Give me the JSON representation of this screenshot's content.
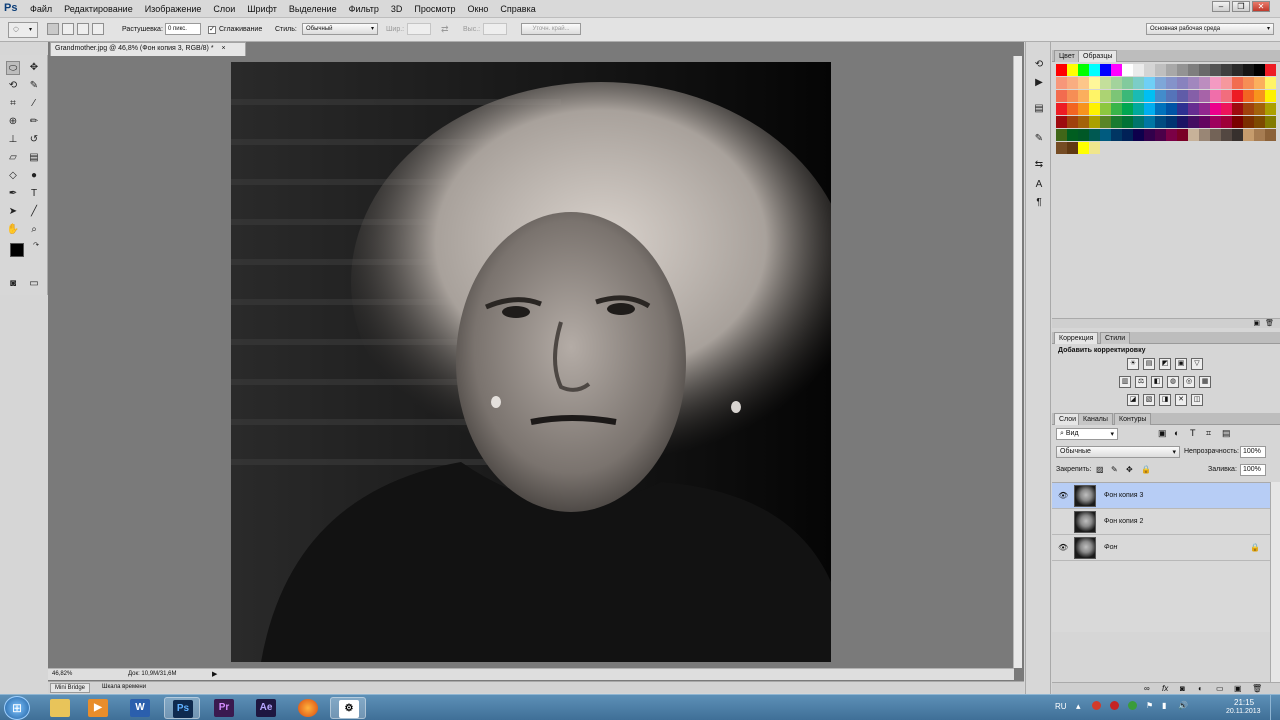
{
  "app": {
    "logo": "Ps"
  },
  "menu": [
    "Файл",
    "Редактирование",
    "Изображение",
    "Слои",
    "Шрифт",
    "Выделение",
    "Фильтр",
    "3D",
    "Просмотр",
    "Окно",
    "Справка"
  ],
  "window_controls": {
    "minimize": "–",
    "restore": "❐",
    "close": "✕"
  },
  "options": {
    "feather_label": "Растушевка:",
    "feather_value": "0 пикс.",
    "antialias_label": "Сглаживание",
    "style_label": "Стиль:",
    "style_value": "Обычный",
    "width_label": "Шир.:",
    "height_label": "Выс.:",
    "refine_button": "Уточн. край...",
    "workspace": "Основная рабочая среда"
  },
  "document": {
    "tab_title": "Grandmother.jpg @ 46,8% (Фон копия 3, RGB/8) *",
    "close": "×",
    "zoom": "46,82%",
    "doc_info": "Док: 10,9M/31,6M"
  },
  "bottom_tabs": [
    "Mini Bridge",
    "Шкала времени"
  ],
  "swatches_panel": {
    "tabs": [
      "Цвет",
      "Образцы"
    ],
    "rows": [
      [
        "#ff0000",
        "#ffff00",
        "#00ff00",
        "#00ffff",
        "#0000ff",
        "#ff00ff",
        "#ffffff",
        "#ebebeb",
        "#d4d4d4",
        "#bfbfbf",
        "#a8a8a8",
        "#939393",
        "#7e7e7e",
        "#696969",
        "#545454",
        "#3f3f3f",
        "#2a2a2a",
        "#151515",
        "#000000",
        "#ed1c24"
      ],
      [
        "#f7977a",
        "#f9ad81",
        "#fdc68a",
        "#fff79a",
        "#c4df9b",
        "#a3d39c",
        "#82ca9d",
        "#7bcdc8",
        "#6ecff6",
        "#7ea7d8",
        "#8493ca",
        "#8882be",
        "#a187be",
        "#bc8dbf",
        "#f49ac2",
        "#f6989d",
        "#f26c4f",
        "#f68e55",
        "#fbaf5d",
        "#fff467"
      ],
      [
        "#f26c4f",
        "#f68e55",
        "#fbaf5d",
        "#fff467",
        "#acd373",
        "#7cc576",
        "#3bb878",
        "#1abbb4",
        "#00bff3",
        "#438ccb",
        "#5574b9",
        "#605ca8",
        "#855fa8",
        "#a763a8",
        "#f06eaa",
        "#f26d7d",
        "#ed1c24",
        "#f26522",
        "#f7941d",
        "#fff200"
      ],
      [
        "#ed1c24",
        "#f26522",
        "#f7941d",
        "#fff200",
        "#8dc73f",
        "#39b54a",
        "#00a651",
        "#00a99d",
        "#00aeef",
        "#0072bc",
        "#0054a6",
        "#2e3192",
        "#662d91",
        "#92278f",
        "#ec008c",
        "#ed145b",
        "#9e0b0f",
        "#a0410d",
        "#a3620a",
        "#aba000"
      ],
      [
        "#9e0b0f",
        "#a0410d",
        "#a3620a",
        "#aba000",
        "#598527",
        "#197b30",
        "#007236",
        "#00746b",
        "#0076a3",
        "#004b80",
        "#003471",
        "#1b1464",
        "#440e62",
        "#630460",
        "#9e005d",
        "#9e0039",
        "#790000",
        "#7b2e00",
        "#7d4900",
        "#827b00"
      ],
      [
        "#406618",
        "#005e20",
        "#005826",
        "#005952",
        "#005b7f",
        "#003663",
        "#002157",
        "#0d004c",
        "#32004b",
        "#4b0049",
        "#7b0046",
        "#7a0026",
        "#c7b299",
        "#998675",
        "#736357",
        "#534741",
        "#37302d",
        "#c69c6d",
        "#a67c52",
        "#8c6239"
      ],
      [
        "#754c24",
        "#603913",
        "#ffff00",
        "#f0e68c"
      ]
    ]
  },
  "adjustments_panel": {
    "tabs": [
      "Коррекция",
      "Стили"
    ],
    "heading": "Добавить корректировку",
    "icons": [
      "☀",
      "▤",
      "◩",
      "▣",
      "▽",
      "▥",
      "⚖",
      "◧",
      "◍",
      "◎",
      "▦",
      "◪",
      "▧",
      "◨",
      "✕",
      "◫"
    ]
  },
  "layers_panel": {
    "tabs": [
      "Слои",
      "Каналы",
      "Контуры"
    ],
    "filter_label": "Вид",
    "blend_mode": "Обычные",
    "opacity_label": "Непрозрачность:",
    "opacity_value": "100%",
    "lock_label": "Закрепить:",
    "fill_label": "Заливка:",
    "fill_value": "100%",
    "layers": [
      {
        "name": "Фон копия 3",
        "visible": true,
        "selected": true
      },
      {
        "name": "Фон копия 2",
        "visible": false,
        "selected": false
      },
      {
        "name": "Фон",
        "visible": true,
        "selected": false,
        "locked": true
      }
    ],
    "footer_icons": [
      "link-icon",
      "fx-icon",
      "mask-icon",
      "adjustment-icon",
      "folder-icon",
      "new-layer-icon",
      "trash-icon"
    ]
  },
  "taskbar": {
    "apps": [
      "Explorer",
      "Media Player",
      "Word",
      "Photoshop",
      "Premiere",
      "After Effects",
      "Firefox",
      "App"
    ],
    "lang": "RU",
    "time": "21:15",
    "date": "20.11.2013"
  }
}
